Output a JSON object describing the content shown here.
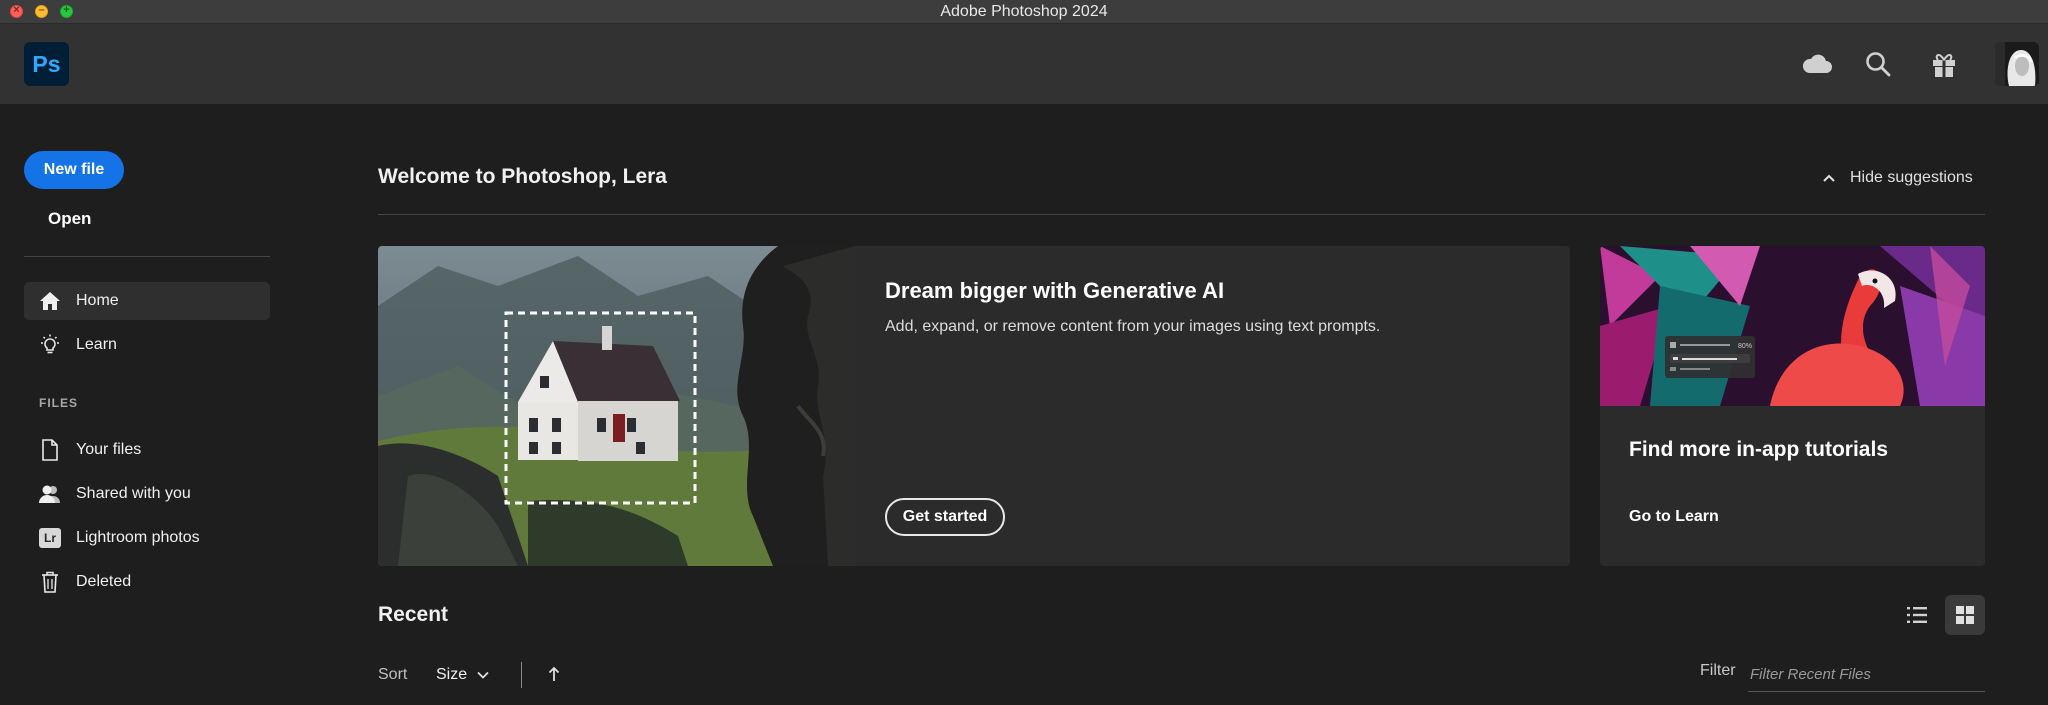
{
  "window": {
    "title": "Adobe Photoshop 2024",
    "controls": {
      "close": "×",
      "minimize": "–",
      "maximize": "+"
    }
  },
  "header": {
    "logo_text": "Ps",
    "icons": [
      "cloud-icon",
      "search-icon",
      "gift-icon",
      "user-avatar"
    ]
  },
  "sidebar": {
    "new_file": "New file",
    "open": "Open",
    "nav": [
      {
        "label": "Home",
        "icon": "home-icon",
        "active": true
      },
      {
        "label": "Learn",
        "icon": "lightbulb-icon",
        "active": false
      }
    ],
    "files_section": "FILES",
    "files": [
      {
        "label": "Your files",
        "icon": "document-icon"
      },
      {
        "label": "Shared with you",
        "icon": "shared-users-icon"
      },
      {
        "label": "Lightroom photos",
        "icon": "lightroom-icon",
        "badge": "Lr"
      },
      {
        "label": "Deleted",
        "icon": "trash-icon"
      }
    ]
  },
  "main": {
    "welcome": "Welcome to Photoshop, Lera",
    "hide_suggestions": "Hide suggestions",
    "ai_card": {
      "title": "Dream bigger with Generative AI",
      "description": "Add, expand, or remove content from your images using text prompts.",
      "cta": "Get started"
    },
    "tutorial_card": {
      "title": "Find more in-app tutorials",
      "link": "Go to Learn",
      "panel_value": "80%"
    },
    "recent": {
      "title": "Recent",
      "sort_label": "Sort",
      "sort_value": "Size",
      "filter_label": "Filter",
      "filter_placeholder": "Filter Recent Files",
      "view_mode": "grid"
    }
  },
  "colors": {
    "accent": "#1473e6",
    "background": "#1e1e1e",
    "panel": "#2b2b2b",
    "header": "#323232"
  }
}
